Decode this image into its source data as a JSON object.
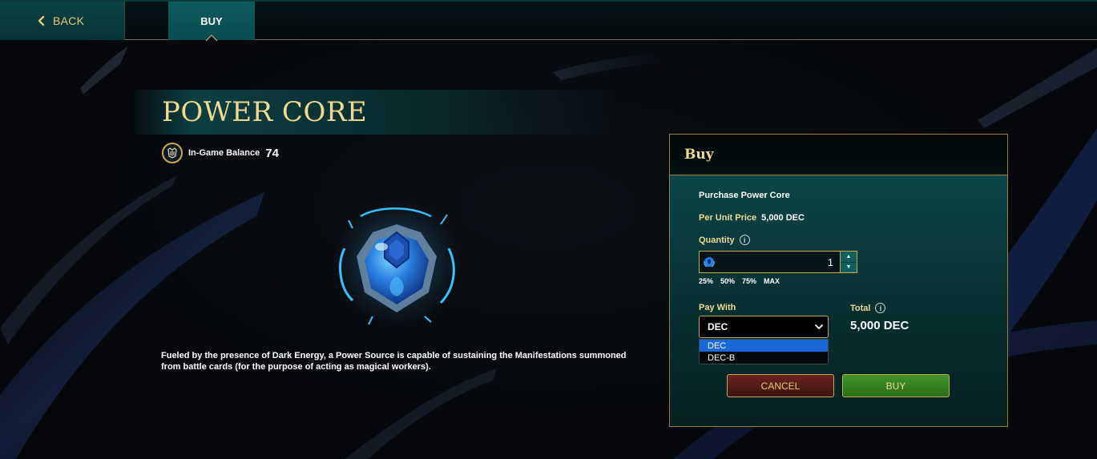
{
  "nav": {
    "back_label": "BACK",
    "tab_buy_label": "BUY"
  },
  "item": {
    "title": "POWER CORE",
    "balance_label": "In-Game Balance",
    "balance_value": "74",
    "description": "Fueled by the presence of Dark Energy, a Power Source is capable of sustaining the Manifestations summoned from battle cards (for the purpose of acting as magical workers)."
  },
  "buy_panel": {
    "header": "Buy",
    "purchase_label": "Purchase Power Core",
    "per_unit_label": "Per Unit Price",
    "per_unit_value": "5,000 DEC",
    "quantity_label": "Quantity",
    "quantity_value": "1",
    "percent_options": [
      "25%",
      "50%",
      "75%",
      "MAX"
    ],
    "pay_with_label": "Pay With",
    "pay_with_selected": "DEC",
    "pay_with_options": [
      "DEC",
      "DEC-B"
    ],
    "total_label": "Total",
    "total_value": "5,000 DEC",
    "info_glyph": "i",
    "cancel_label": "CANCEL",
    "buy_label": "BUY"
  },
  "colors": {
    "accent_gold": "#f0d990",
    "panel_teal": "#0c4c4f",
    "cancel_red": "#6a2420",
    "buy_green": "#3f9526",
    "dropdown_highlight": "#1a67d8"
  },
  "icons": {
    "back": "chevron-left-icon",
    "balance": "dark-energy-crystal-icon",
    "quantity_item": "power-core-icon",
    "info": "info-icon",
    "select_arrow": "chevron-down-icon"
  }
}
